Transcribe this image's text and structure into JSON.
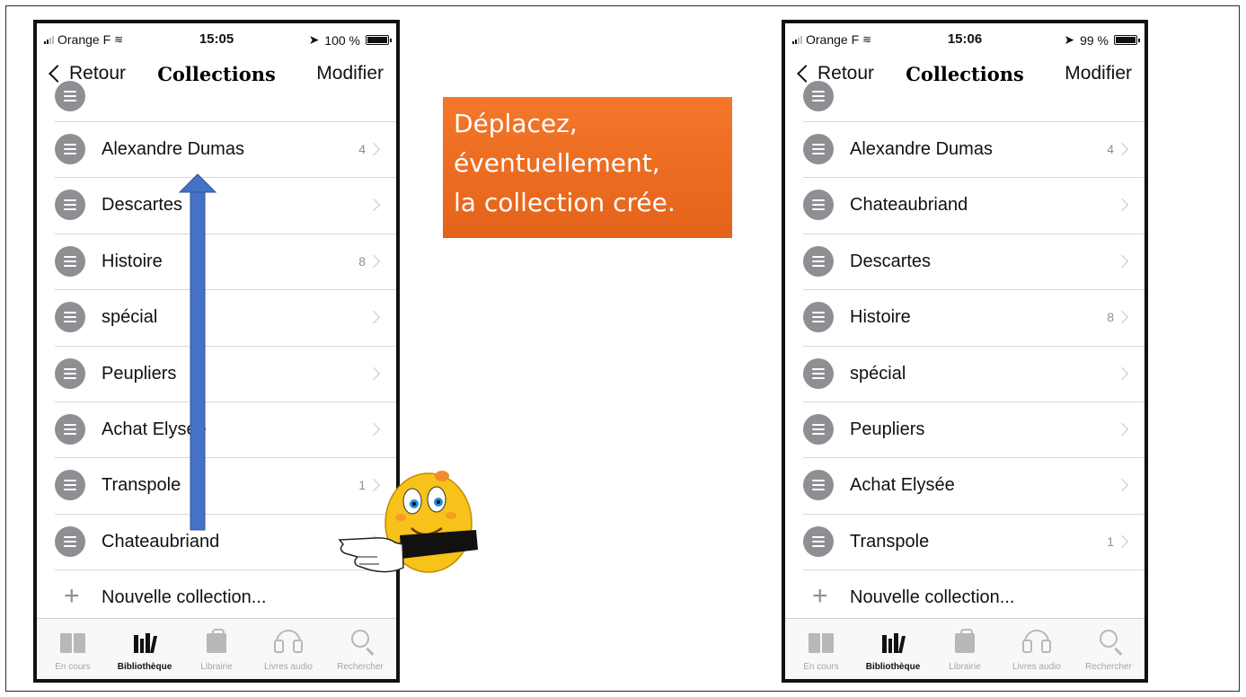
{
  "callout": {
    "lines": [
      "Déplacez,",
      "éventuellement,",
      "la collection crée."
    ],
    "color": "#ed6c21"
  },
  "phone_left": {
    "status": {
      "carrier": "Orange F",
      "time": "15:05",
      "battery": "100 %",
      "battery_level": 1.0
    },
    "nav": {
      "back": "Retour",
      "title": "Collections",
      "edit": "Modifier"
    },
    "rows": [
      {
        "label": "Alexandre Dumas",
        "count": "4"
      },
      {
        "label": "Descartes",
        "count": ""
      },
      {
        "label": "Histoire",
        "count": "8"
      },
      {
        "label": "spécial",
        "count": ""
      },
      {
        "label": "Peupliers",
        "count": ""
      },
      {
        "label": "Achat Elysée",
        "count": ""
      },
      {
        "label": "Transpole",
        "count": "1"
      },
      {
        "label": "Chateaubriand",
        "count": ""
      }
    ],
    "new_collection": "Nouvelle collection...",
    "tabs": [
      "En cours",
      "Bibliothèque",
      "Librairie",
      "Livres audio",
      "Rechercher"
    ]
  },
  "phone_right": {
    "status": {
      "carrier": "Orange F",
      "time": "15:06",
      "battery": "99 %",
      "battery_level": 0.99
    },
    "nav": {
      "back": "Retour",
      "title": "Collections",
      "edit": "Modifier"
    },
    "rows": [
      {
        "label": "Alexandre Dumas",
        "count": "4"
      },
      {
        "label": "Chateaubriand",
        "count": ""
      },
      {
        "label": "Descartes",
        "count": ""
      },
      {
        "label": "Histoire",
        "count": "8"
      },
      {
        "label": "spécial",
        "count": ""
      },
      {
        "label": "Peupliers",
        "count": ""
      },
      {
        "label": "Achat Elysée",
        "count": ""
      },
      {
        "label": "Transpole",
        "count": "1"
      }
    ],
    "new_collection": "Nouvelle collection...",
    "tabs": [
      "En cours",
      "Bibliothèque",
      "Librairie",
      "Livres audio",
      "Rechercher"
    ]
  },
  "annotation": {
    "arrow_color": "#4472c4"
  }
}
